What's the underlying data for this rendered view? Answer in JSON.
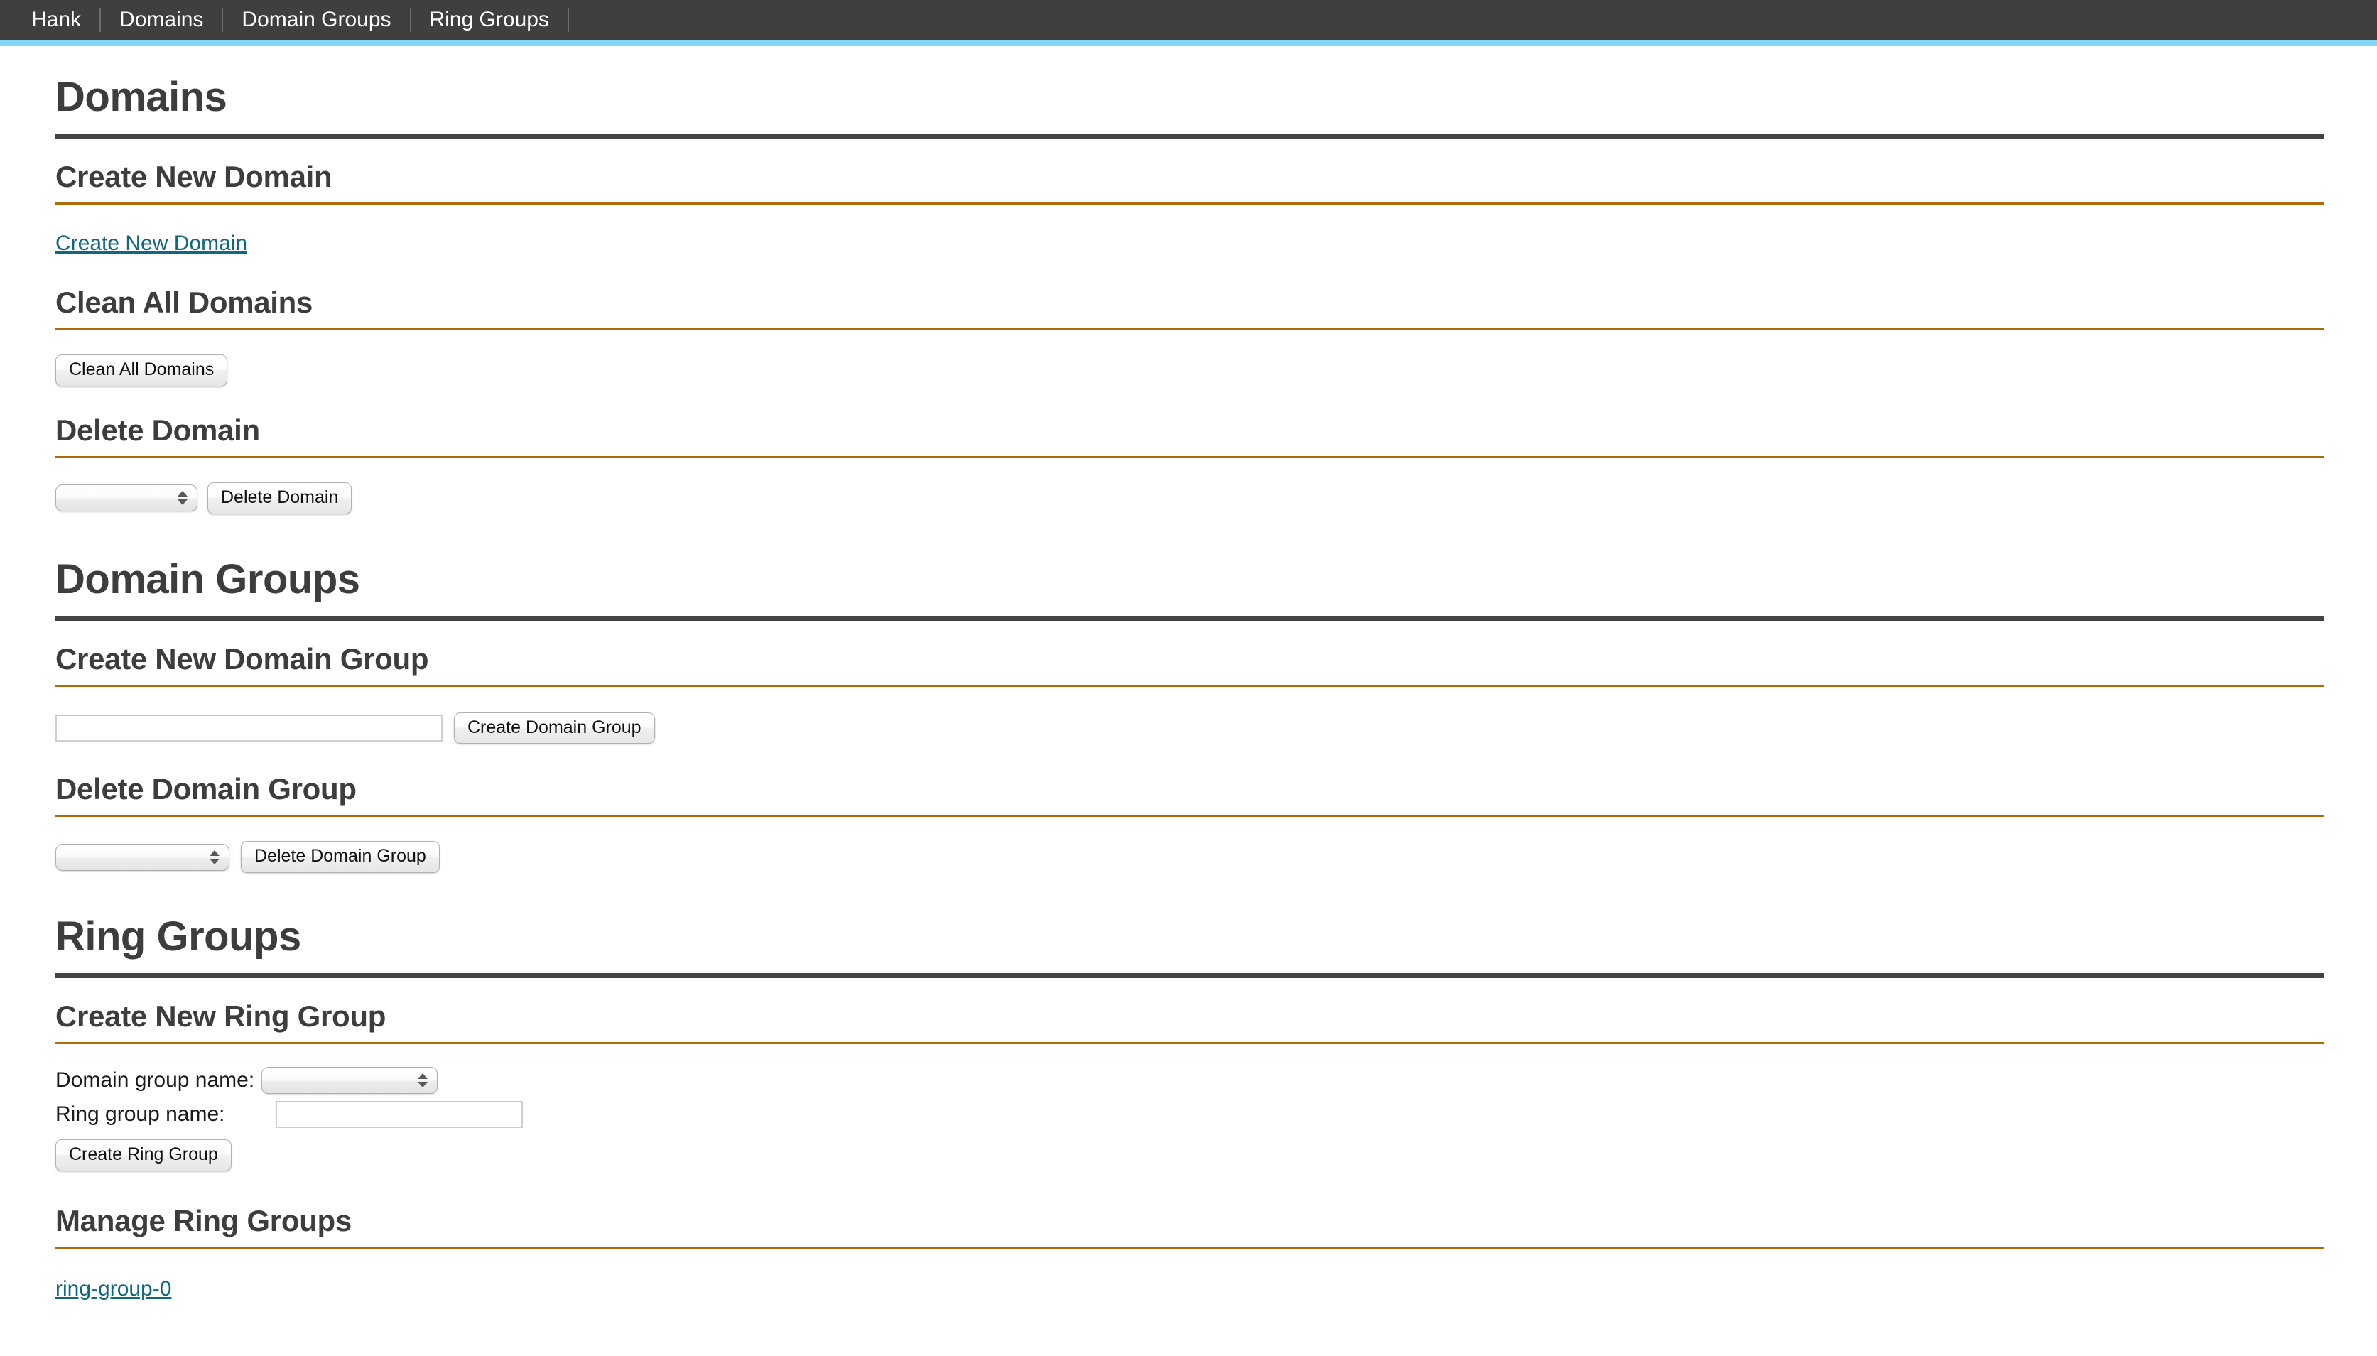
{
  "nav": {
    "items": [
      {
        "label": "Hank",
        "name": "nav-item-hank"
      },
      {
        "label": "Domains",
        "name": "nav-item-domains"
      },
      {
        "label": "Domain Groups",
        "name": "nav-item-domain-groups"
      },
      {
        "label": "Ring Groups",
        "name": "nav-item-ring-groups"
      }
    ],
    "accent_color": "#85d8f4",
    "background_color": "#3f3f3f"
  },
  "colors": {
    "heading": "#3d3d3d",
    "rule_dark": "#434343",
    "rule_orange": "#b06a08",
    "link": "#11687e"
  },
  "domains": {
    "title": "Domains",
    "create": {
      "heading": "Create New Domain",
      "link_label": "Create New Domain"
    },
    "clean": {
      "heading": "Clean All Domains",
      "button_label": "Clean All Domains"
    },
    "delete": {
      "heading": "Delete Domain",
      "select_value": "",
      "button_label": "Delete Domain"
    }
  },
  "domain_groups": {
    "title": "Domain Groups",
    "create": {
      "heading": "Create New Domain Group",
      "input_value": "",
      "input_placeholder": "",
      "button_label": "Create Domain Group"
    },
    "delete": {
      "heading": "Delete Domain Group",
      "select_value": "",
      "button_label": "Delete Domain Group"
    }
  },
  "ring_groups": {
    "title": "Ring Groups",
    "create": {
      "heading": "Create New Ring Group",
      "domain_group_label": "Domain group name:",
      "domain_group_value": "",
      "ring_group_label": "Ring group name:",
      "ring_group_value": "",
      "ring_group_placeholder": "",
      "button_label": "Create Ring Group"
    },
    "manage": {
      "heading": "Manage Ring Groups",
      "items": [
        {
          "label": "ring-group-0"
        }
      ]
    }
  }
}
